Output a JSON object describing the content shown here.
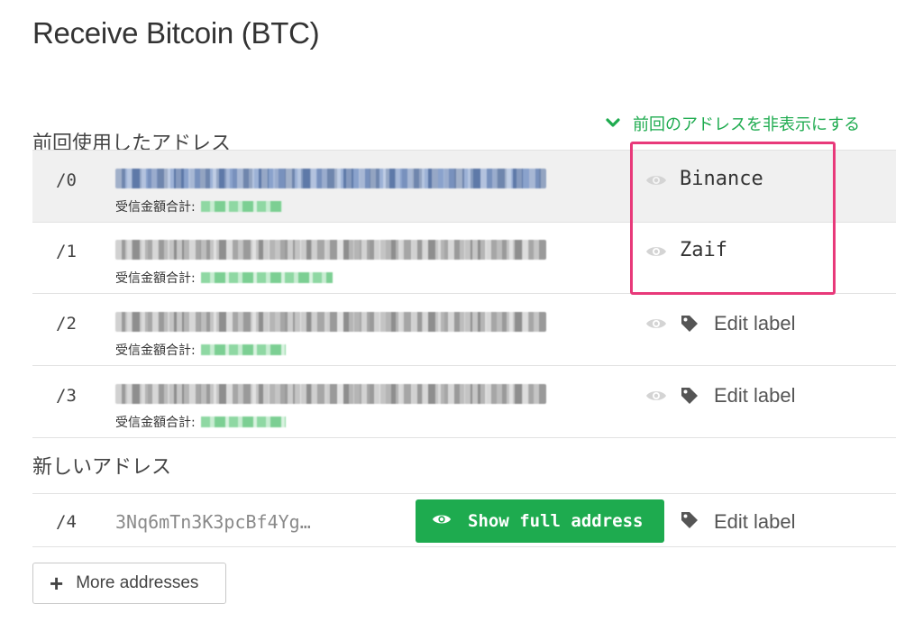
{
  "page": {
    "title": "Receive Bitcoin (BTC)"
  },
  "toggle": {
    "label": "前回のアドレスを非表示にする"
  },
  "sections": {
    "previous_title": "前回使用したアドレス",
    "new_title": "新しいアドレス"
  },
  "previous_addresses": [
    {
      "index": "/0",
      "total_label": "受信金額合計:",
      "label": "Binance",
      "highlighted": true
    },
    {
      "index": "/1",
      "total_label": "受信金額合計:",
      "label": "Zaif"
    },
    {
      "index": "/2",
      "total_label": "受信金額合計:",
      "label": "Edit label"
    },
    {
      "index": "/3",
      "total_label": "受信金額合計:",
      "label": "Edit label"
    }
  ],
  "new_address": {
    "index": "/4",
    "address": "3Nq6mTn3K3pcBf4Yg…",
    "show_button_label": "Show full address",
    "edit_label": "Edit label"
  },
  "more_button": {
    "label": "More addresses"
  },
  "icons": {
    "chevron": "chevron-down-icon",
    "eye": "eye-icon",
    "tag": "tag-icon",
    "plus": "plus-icon"
  },
  "colors": {
    "accent_green": "#1eab4f",
    "highlight_pink": "#e8397a",
    "row_highlight": "#f0f0f0"
  }
}
